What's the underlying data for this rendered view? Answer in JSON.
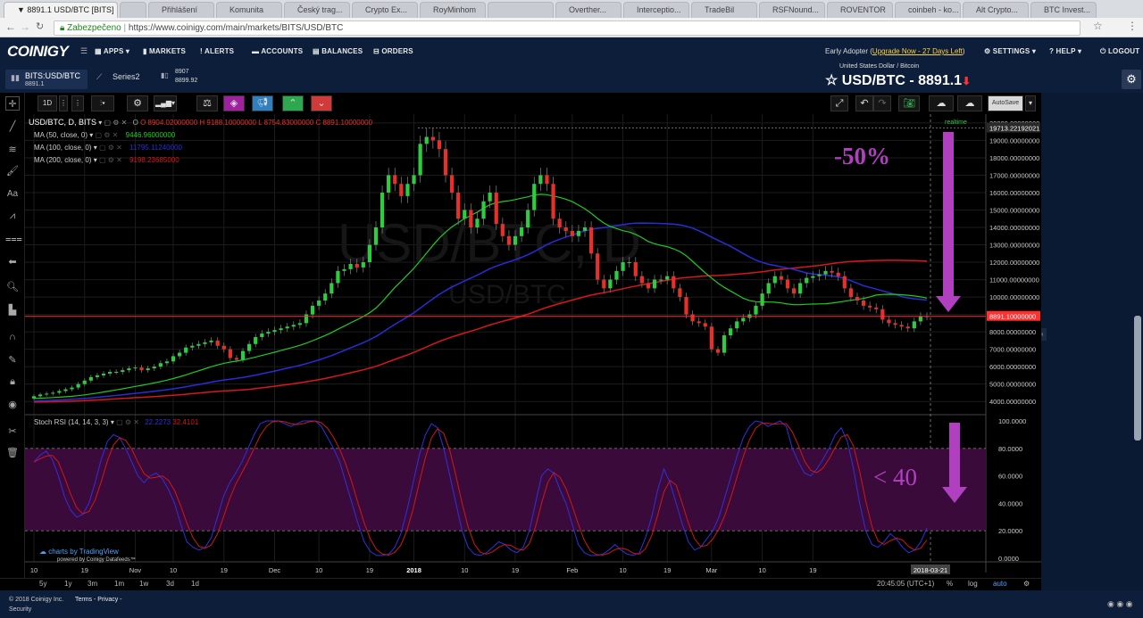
{
  "browser": {
    "tabs": [
      {
        "label": "▼ 8891.1 USD/BTC [BITS]",
        "active": true
      },
      {
        "label": ""
      },
      {
        "label": "Přihlášení"
      },
      {
        "label": "Komunita"
      },
      {
        "label": "Český trag..."
      },
      {
        "label": "Crypto Ex..."
      },
      {
        "label": "RoyMinhom"
      },
      {
        "label": ""
      },
      {
        "label": "Overther..."
      },
      {
        "label": "Interceptio..."
      },
      {
        "label": "TradeBil"
      },
      {
        "label": "RSFNound..."
      },
      {
        "label": "ROVENTOR"
      },
      {
        "label": "coinbeh - ko..."
      },
      {
        "label": "Alt Crypto..."
      },
      {
        "label": "BTC Invest..."
      }
    ],
    "secure_label": "Zabezpečeno",
    "url": "https://www.coinigy.com/main/markets/BITS/USD/BTC"
  },
  "nav": {
    "logo": "COINIGY",
    "items": [
      "APPS",
      "MARKETS",
      "ALERTS",
      "ACCOUNTS",
      "BALANCES",
      "ORDERS"
    ],
    "plan_prefix": "Early Adopter (",
    "plan_link": "Upgrade Now - 27 Days Left",
    "plan_suffix": ")",
    "right": [
      "SETTINGS",
      "HELP",
      "LOGOUT"
    ]
  },
  "subheader": {
    "market": "BITS:USD/BTC",
    "market_price": "8891.1",
    "series": "Series2",
    "bid": "8907",
    "ask": "8899.92",
    "pair_desc": "United States Dollar / Bitcoin",
    "pair_title": "USD/BTC - 8891.1"
  },
  "toolbar": {
    "interval": "1D",
    "autosave": "AutoSave"
  },
  "chart_data": {
    "type": "candlestick",
    "symbol": "USD/BTC, D, BITS",
    "ohlc_label": {
      "o": "O 8904.02000000",
      "h": "H 9188.10000000",
      "l": "L 8754.83000000",
      "c": "C 8891.10000000"
    },
    "ma": [
      {
        "label": "MA (50, close, 0)",
        "value": "9446.96000000",
        "color": "#00c800"
      },
      {
        "label": "MA (100, close, 0)",
        "value": "11795.11240000",
        "color": "#2020ff"
      },
      {
        "label": "MA (200, close, 0)",
        "value": "9198.23685000",
        "color": "#e01010"
      }
    ],
    "watermark": "USD/BTC, D",
    "watermark2": "USD/BTC",
    "realtime_label": "realtime",
    "y_ticks": [
      "20000.00000000",
      "19000.00000000",
      "18000.00000000",
      "17000.00000000",
      "16000.00000000",
      "15000.00000000",
      "14000.00000000",
      "13000.00000000",
      "12000.00000000",
      "11000.00000000",
      "10000.00000000",
      "9000.00000000",
      "8000.00000000",
      "7000.00000000",
      "6000.00000000",
      "5000.00000000",
      "4000.00000000"
    ],
    "y_range": [
      3600,
      20200
    ],
    "top_price_label": "19713.22192021",
    "current_price_label": "8891.10000000",
    "current_price": 8891.1,
    "x_ticks": [
      "10",
      "19",
      "Nov",
      "10",
      "19",
      "Dec",
      "10",
      "19",
      "2018",
      "10",
      "19",
      "Feb",
      "10",
      "19",
      "Mar",
      "10",
      "19"
    ],
    "current_date": "2018-03-21",
    "closes": [
      4300,
      4400,
      4450,
      4500,
      4600,
      4700,
      4800,
      5000,
      5200,
      5400,
      5500,
      5600,
      5700,
      5700,
      5800,
      5900,
      5950,
      5800,
      5900,
      6000,
      6200,
      6300,
      6600,
      6800,
      7100,
      7200,
      7300,
      7400,
      7500,
      7200,
      7000,
      6500,
      6400,
      6900,
      7300,
      7700,
      7900,
      8000,
      8100,
      8200,
      8300,
      8400,
      8500,
      9000,
      9500,
      9800,
      10200,
      10800,
      11500,
      11600,
      11900,
      11700,
      12000,
      13000,
      14000,
      16000,
      17000,
      16500,
      15800,
      16500,
      17000,
      18800,
      19200,
      19000,
      18500,
      17000,
      16000,
      14500,
      15000,
      14000,
      14500,
      15500,
      16000,
      14200,
      13500,
      13000,
      13500,
      14000,
      15000,
      16500,
      17000,
      16500,
      14500,
      14000,
      13800,
      13500,
      13800,
      14000,
      12500,
      11000,
      10500,
      11000,
      11500,
      12000,
      12000,
      11200,
      10800,
      10500,
      11000,
      11000,
      11200,
      10500,
      10000,
      9000,
      8600,
      8500,
      8300,
      7000,
      6800,
      7800,
      8200,
      8600,
      8800,
      9000,
      9500,
      10200,
      10800,
      11200,
      11000,
      10500,
      10200,
      10800,
      11100,
      11200,
      11300,
      11500,
      11400,
      11200,
      10500,
      10000,
      9800,
      9500,
      9400,
      9300,
      8700,
      8500,
      8400,
      8300,
      8200,
      8600,
      8900,
      8891
    ]
  },
  "stoch": {
    "label": "Stoch RSI (14, 14, 3, 3)",
    "k_value": "22.2273",
    "d_value": "32.4101",
    "y_ticks": [
      "100.0000",
      "80.0000",
      "60.0000",
      "40.0000",
      "20.0000",
      "0.0000"
    ],
    "k": [
      70,
      75,
      78,
      72,
      60,
      45,
      35,
      30,
      32,
      40,
      55,
      72,
      85,
      90,
      88,
      80,
      70,
      60,
      55,
      60,
      62,
      58,
      50,
      40,
      25,
      12,
      8,
      6,
      8,
      15,
      30,
      45,
      55,
      62,
      70,
      80,
      90,
      98,
      100,
      100,
      100,
      98,
      96,
      98,
      100,
      100,
      100,
      96,
      88,
      80,
      70,
      55,
      40,
      25,
      12,
      5,
      2,
      2,
      3,
      8,
      18,
      35,
      55,
      75,
      90,
      98,
      95,
      80,
      60,
      40,
      20,
      8,
      3,
      2,
      4,
      8,
      12,
      10,
      6,
      4,
      8,
      20,
      40,
      60,
      65,
      62,
      50,
      40,
      25,
      10,
      4,
      2,
      2,
      3,
      6,
      10,
      6,
      3,
      2,
      4,
      15,
      30,
      50,
      65,
      55,
      40,
      25,
      12,
      6,
      8,
      14,
      20,
      30,
      45,
      60,
      75,
      88,
      96,
      100,
      99,
      96,
      98,
      100,
      96,
      80,
      70,
      62,
      60,
      65,
      72,
      80,
      90,
      95,
      85,
      65,
      40,
      20,
      10,
      8,
      12,
      18,
      14,
      8,
      4,
      6,
      12,
      22
    ]
  },
  "annotations": {
    "drop": "-50%",
    "stoch_note": "< 40"
  },
  "branding": {
    "tv": "charts by TradingView",
    "tv_sub": "powered by Coinigy Datafeeds™"
  },
  "bottom": {
    "ranges": [
      "5y",
      "1y",
      "3m",
      "1m",
      "1w",
      "3d",
      "1d"
    ],
    "time": "20:45:05 (UTC+1)",
    "options": [
      "%",
      "log",
      "auto"
    ]
  },
  "footer": {
    "copyright": "© 2018 Coinigy Inc.",
    "links": "Terms - Privacy -",
    "security": "Security"
  },
  "colors": {
    "up": "#2ecc40",
    "down": "#e8302a",
    "ma50": "#1fcc1f",
    "ma100": "#2b2bd8",
    "ma200": "#d81818",
    "stoch_k": "#3030e0",
    "stoch_d": "#d01818",
    "band": "#3a0a3a",
    "annot": "#b040c0",
    "accent_price": "#ff3030"
  }
}
